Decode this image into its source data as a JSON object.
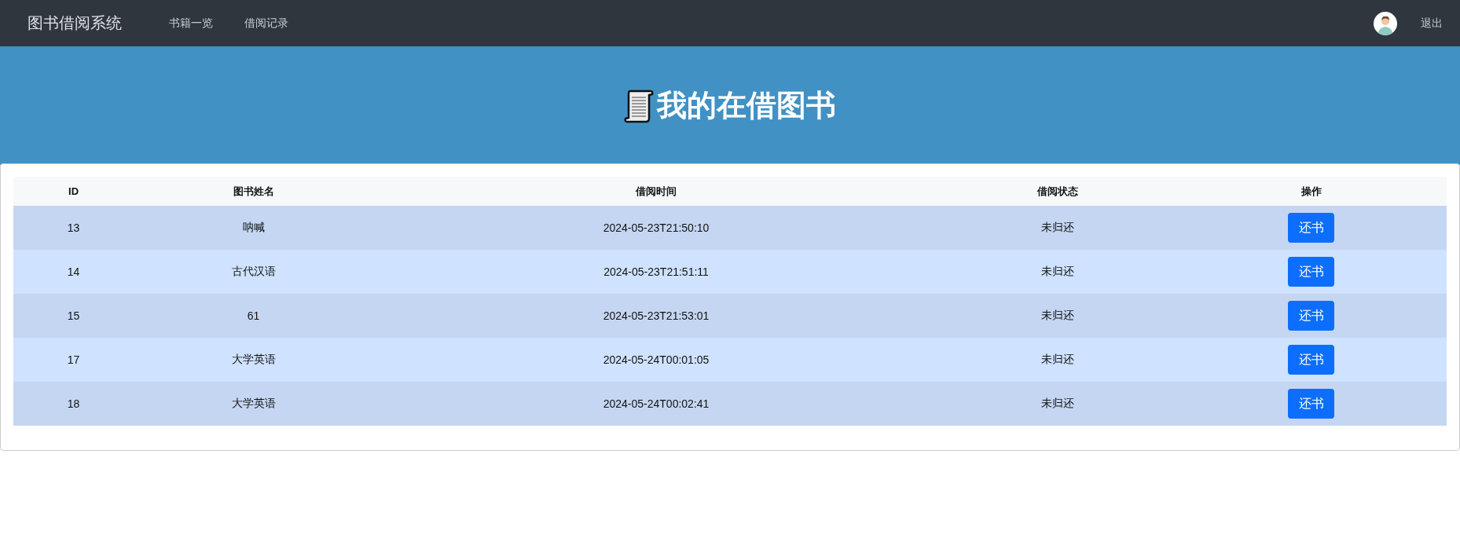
{
  "navbar": {
    "brand": "图书借阅系统",
    "links": [
      {
        "label": "书籍一览",
        "selected": false
      },
      {
        "label": "借阅记录",
        "selected": false
      }
    ],
    "logout": "退出"
  },
  "banner": {
    "title": "我的在借图书"
  },
  "table": {
    "columns": [
      "ID",
      "图书姓名",
      "借阅时间",
      "借阅状态",
      "操作"
    ],
    "rows": [
      {
        "id": "13",
        "title": "呐喊",
        "time": "2024-05-23T21:50:10",
        "status": "未归还",
        "action": "还书"
      },
      {
        "id": "14",
        "title": "古代汉语",
        "time": "2024-05-23T21:51:11",
        "status": "未归还",
        "action": "还书"
      },
      {
        "id": "15",
        "title": "61",
        "time": "2024-05-23T21:53:01",
        "status": "未归还",
        "action": "还书"
      },
      {
        "id": "17",
        "title": "大学英语",
        "time": "2024-05-24T00:01:05",
        "status": "未归还",
        "action": "还书"
      },
      {
        "id": "18",
        "title": "大学英语",
        "time": "2024-05-24T00:02:41",
        "status": "未归还",
        "action": "还书"
      }
    ]
  }
}
